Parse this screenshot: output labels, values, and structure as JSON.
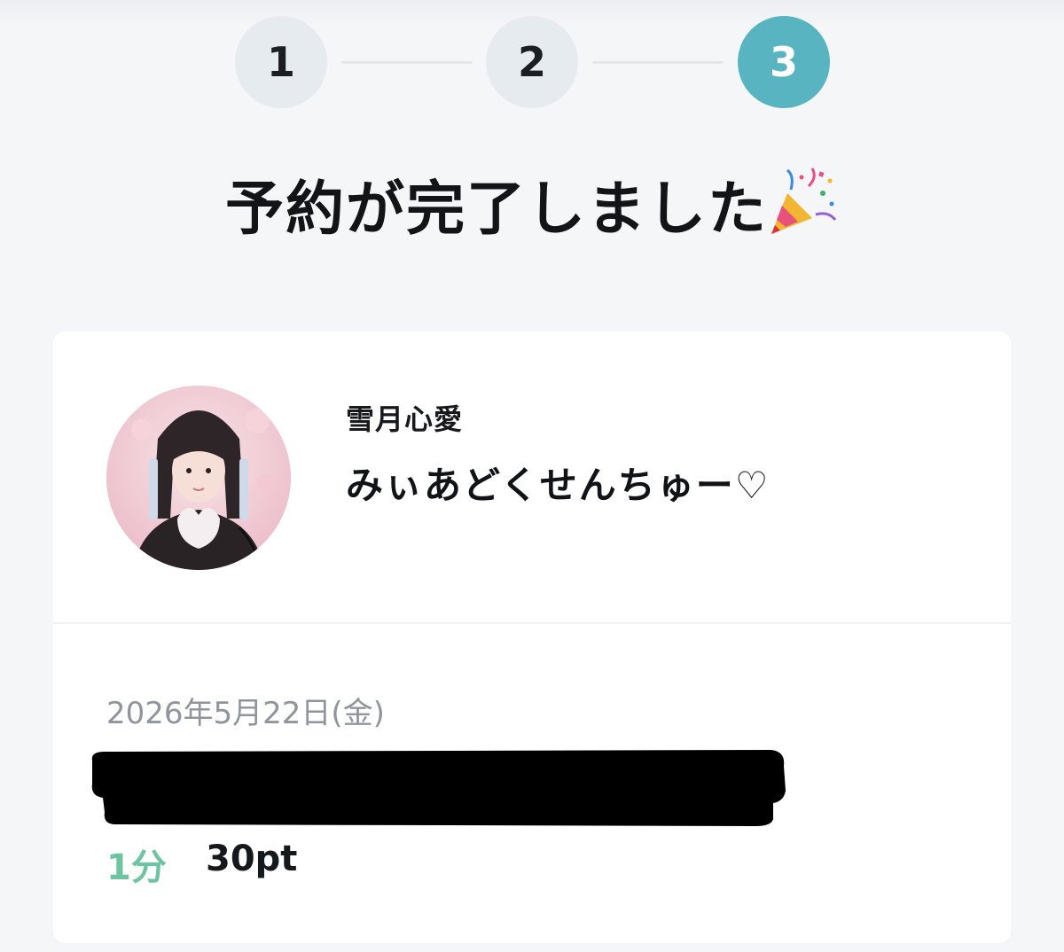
{
  "stepper": {
    "steps": [
      {
        "label": "1",
        "state": "done"
      },
      {
        "label": "2",
        "state": "done"
      },
      {
        "label": "3",
        "state": "current"
      }
    ],
    "active_color": "#59b4c1",
    "inactive_color": "#e6ebf0"
  },
  "page": {
    "title": "予約が完了しました",
    "title_icon": "party-popper-icon"
  },
  "reservation": {
    "idol_name": "雪月心愛",
    "tagline": "みぃあどくせんちゅー♡",
    "date": "2026年5月22日(金)",
    "duration": "1分",
    "price": "30pt",
    "duration_color": "#6cc4a1"
  }
}
